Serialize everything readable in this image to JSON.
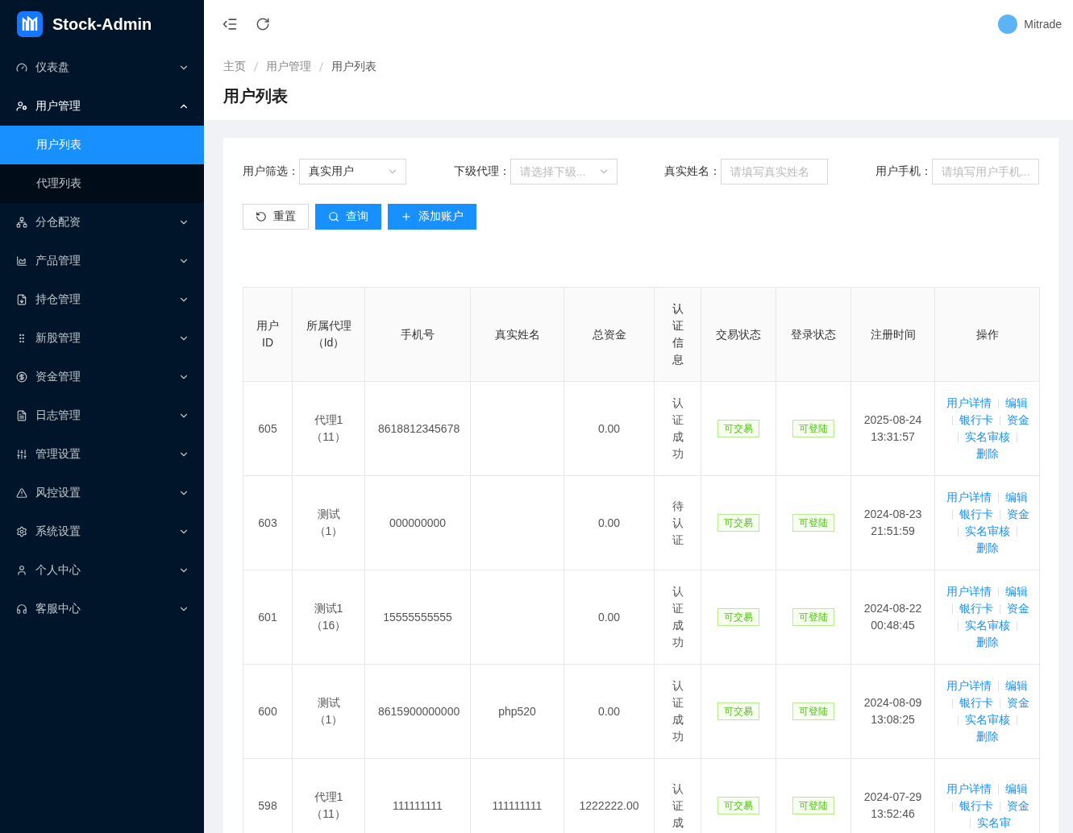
{
  "brand": {
    "name": "Stock-Admin"
  },
  "sidebar": {
    "items": [
      {
        "label": "仪表盘",
        "expanded": false
      },
      {
        "label": "用户管理",
        "expanded": true,
        "children": [
          {
            "label": "用户列表",
            "selected": true
          },
          {
            "label": "代理列表",
            "selected": false
          }
        ]
      },
      {
        "label": "分仓配资",
        "expanded": false
      },
      {
        "label": "产品管理",
        "expanded": false
      },
      {
        "label": "持仓管理",
        "expanded": false
      },
      {
        "label": "新股管理",
        "expanded": false
      },
      {
        "label": "资金管理",
        "expanded": false
      },
      {
        "label": "日志管理",
        "expanded": false
      },
      {
        "label": "管理设置",
        "expanded": false
      },
      {
        "label": "风控设置",
        "expanded": false
      },
      {
        "label": "系统设置",
        "expanded": false
      },
      {
        "label": "个人中心",
        "expanded": false
      },
      {
        "label": "客服中心",
        "expanded": false
      }
    ]
  },
  "header": {
    "user": "Mitrade"
  },
  "breadcrumb": [
    "主页",
    "用户管理",
    "用户列表"
  ],
  "page_title": "用户列表",
  "filters": [
    {
      "label": "用户筛选：",
      "kind": "select",
      "value": "真实用户"
    },
    {
      "label": "下级代理：",
      "kind": "select",
      "placeholder": "请选择下级..."
    },
    {
      "label": "真实姓名：",
      "kind": "input",
      "placeholder": "请填写真实姓名"
    },
    {
      "label": "用户手机：",
      "kind": "input",
      "placeholder": "请填写用户手机..."
    }
  ],
  "buttons": [
    {
      "label": "重置",
      "kind": "reset"
    },
    {
      "label": "查询",
      "kind": "search"
    },
    {
      "label": "添加账户",
      "kind": "add"
    }
  ],
  "table": {
    "columns": [
      "用户ID",
      "所属代理（Id）",
      "手机号",
      "真实姓名",
      "总资金",
      "认证信息",
      "交易状态",
      "登录状态",
      "注册时间",
      "操作"
    ],
    "rows": [
      {
        "id": "605",
        "agent": "代理1（11）",
        "phone": "8618812345678",
        "funds": "0.00",
        "cert": "认证成功",
        "trade": "可交易",
        "login": "可登陆",
        "time": "2025-08-24 13:31:57",
        "actions": [
          "用户详情",
          "编辑",
          "银行卡",
          "资金",
          "实名审核",
          "删除"
        ]
      },
      {
        "id": "603",
        "agent": "测试（1）",
        "phone": "000000000",
        "funds": "0.00",
        "cert": "待认证",
        "trade": "可交易",
        "login": "可登陆",
        "time": "2024-08-23 21:51:59",
        "actions": [
          "用户详情",
          "编辑",
          "银行卡",
          "资金",
          "实名审核",
          "删除"
        ]
      },
      {
        "id": "601",
        "agent": "测试1（16）",
        "phone": "15555555555",
        "funds": "0.00",
        "cert": "认证成功",
        "trade": "可交易",
        "login": "可登陆",
        "time": "2024-08-22 00:48:45",
        "actions": [
          "用户详情",
          "编辑",
          "银行卡",
          "资金",
          "实名审核",
          "删除"
        ]
      },
      {
        "id": "600",
        "agent": "测试（1）",
        "phone": "8615900000000",
        "name": "php520",
        "funds": "0.00",
        "cert": "认证成功",
        "trade": "可交易",
        "login": "可登陆",
        "time": "2024-08-09 13:08:25",
        "actions": [
          "用户详情",
          "编辑",
          "银行卡",
          "资金",
          "实名审核",
          "删除"
        ]
      },
      {
        "id": "598",
        "agent": "代理1（11）",
        "phone": "111111111",
        "name": "111111111",
        "funds": "1222222.00",
        "cert": "认证成",
        "trade": "可交易",
        "login": "可登陆",
        "time": "2024-07-29 13:52:46",
        "actions": [
          "用户详情",
          "编辑",
          "银行卡",
          "资金",
          "实名审"
        ]
      }
    ]
  }
}
